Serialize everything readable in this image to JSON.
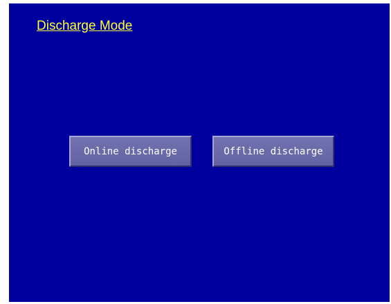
{
  "header": {
    "title": "Discharge Mode"
  },
  "buttons": {
    "online_label": "Online discharge",
    "offline_label": "Offline discharge"
  },
  "colors": {
    "background": "#00009e",
    "title": "#ffff33",
    "button_face": "#6b6baa",
    "button_text": "#ffffff"
  }
}
